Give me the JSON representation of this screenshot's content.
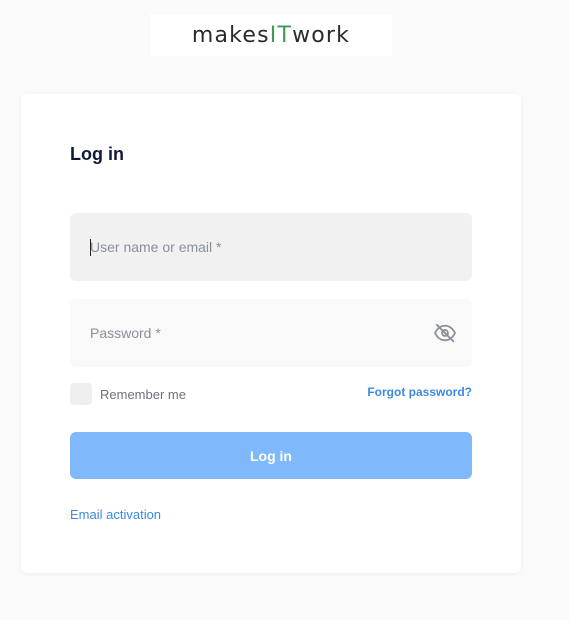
{
  "logo": {
    "part1": "makes",
    "part2": "IT",
    "part3": "work"
  },
  "login": {
    "title": "Log in",
    "username_placeholder": "User name or email *",
    "password_placeholder": "Password *",
    "remember_label": "Remember me",
    "forgot_label": "Forgot password?",
    "submit_label": "Log in",
    "activation_label": "Email activation"
  },
  "icons": {
    "password_toggle": "eye-slash-icon"
  },
  "colors": {
    "primary": "#7fb9fb",
    "link": "#3b8be0",
    "logo_accent": "#3f9a55",
    "title": "#0f1a3a"
  }
}
